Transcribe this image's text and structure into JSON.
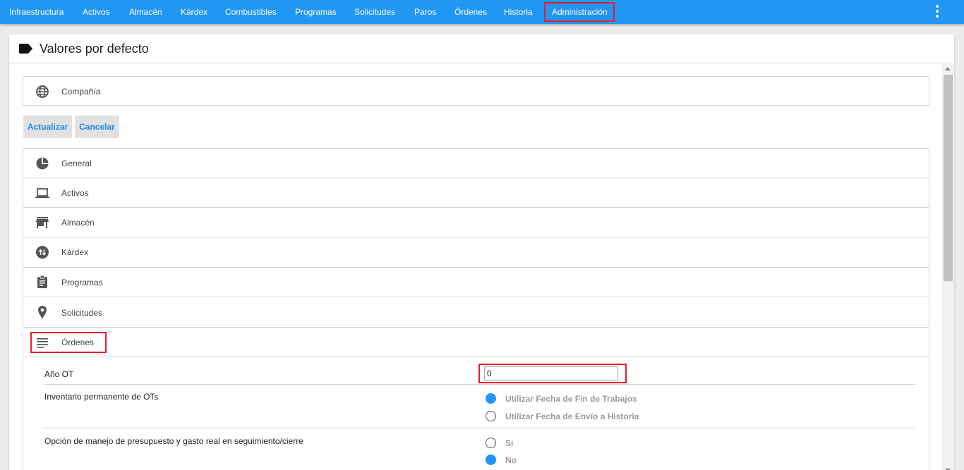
{
  "nav": {
    "items": [
      "Infraestructura",
      "Activos",
      "Almacén",
      "Kárdex",
      "Combustibles",
      "Programas",
      "Solicitudes",
      "Paros",
      "Órdenes",
      "Historia",
      "Administración"
    ]
  },
  "page": {
    "title": "Valores por defecto"
  },
  "company": {
    "label": "Compañía"
  },
  "buttons": {
    "update": "Actualizar",
    "cancel": "Cancelar"
  },
  "sections": {
    "general": "General",
    "activos": "Activos",
    "almacen": "Almacén",
    "kardex": "Kárdex",
    "programas": "Programas",
    "solicitudes": "Solicitudes",
    "ordenes": "Órdenes"
  },
  "ordenes_fields": {
    "anio_ot": {
      "label": "Año OT",
      "value": "0"
    },
    "inventario": {
      "label": "Inventario permanente de OTs",
      "options": [
        "Utilizar Fecha de Fin de Trabajos",
        "Utilizar Fecha de Envío a Historia"
      ],
      "selected": "Utilizar Fecha de Fin de Trabajos"
    },
    "presupuesto": {
      "label": "Opción de manejo de presupuesto y gasto real en seguimiento/cierre",
      "options": [
        "Si",
        "No"
      ],
      "selected": "No"
    }
  },
  "colors": {
    "accent": "#2196f3",
    "highlight": "#e0202a"
  },
  "icons": [
    "globe-icon",
    "pie-chart-icon",
    "laptop-icon",
    "store-icon",
    "swap-icon",
    "clipboard-icon",
    "location-pin-icon",
    "list-icon",
    "label-icon",
    "more-vert-icon"
  ]
}
